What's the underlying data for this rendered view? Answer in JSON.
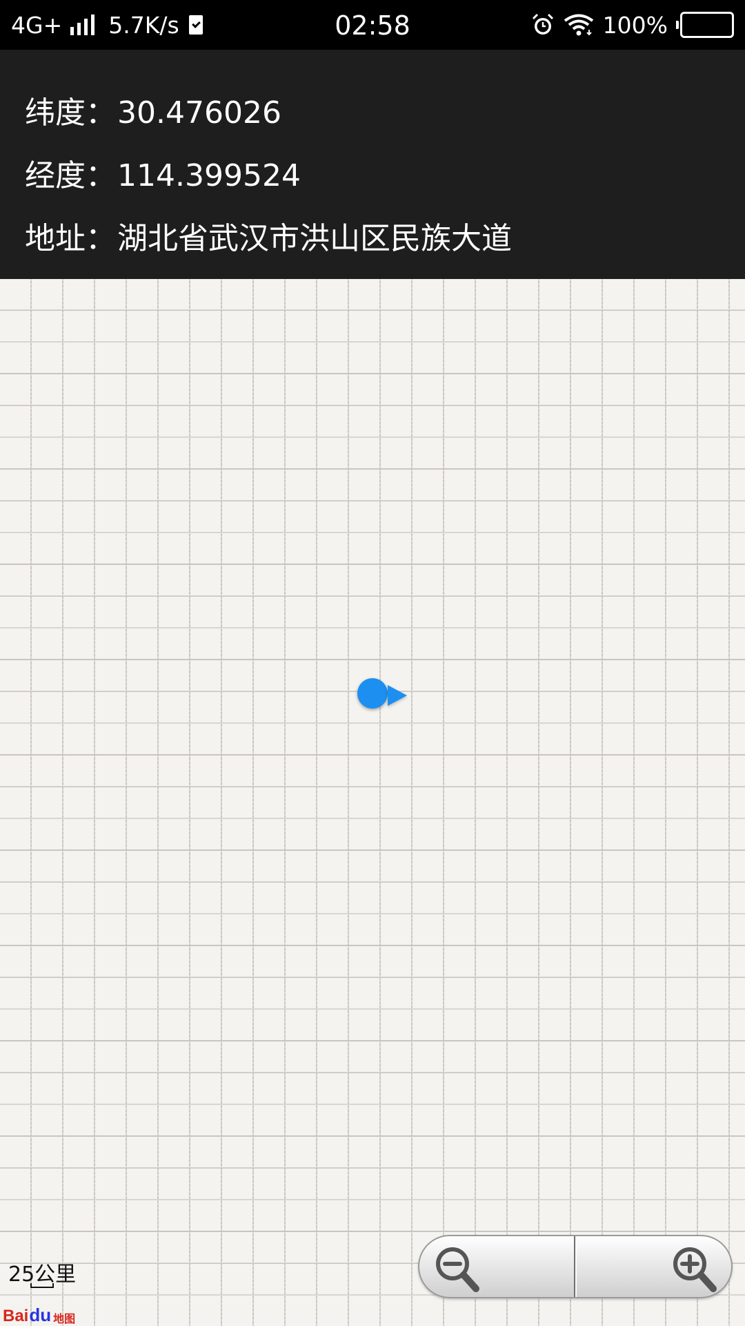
{
  "status_bar": {
    "network": "4G+",
    "speed": "5.7K/s",
    "time": "02:58",
    "battery": "100%"
  },
  "location_info": {
    "latitude_label": "纬度：",
    "latitude_value": "30.476026",
    "longitude_label": "经度：",
    "longitude_value": "114.399524",
    "address_label": "地址：",
    "address_value": "湖北省武汉市洪山区民族大道"
  },
  "map": {
    "scale": "25公里",
    "logo_text": "Bai",
    "logo_paw": "du",
    "logo_ditu": "地图",
    "marker_color": "#1c8ff0"
  },
  "icons": {
    "zoom_out": "zoom-out-magnifier",
    "zoom_in": "zoom-in-magnifier",
    "alarm": "alarm-clock",
    "wifi": "wifi",
    "battery": "battery-full"
  }
}
